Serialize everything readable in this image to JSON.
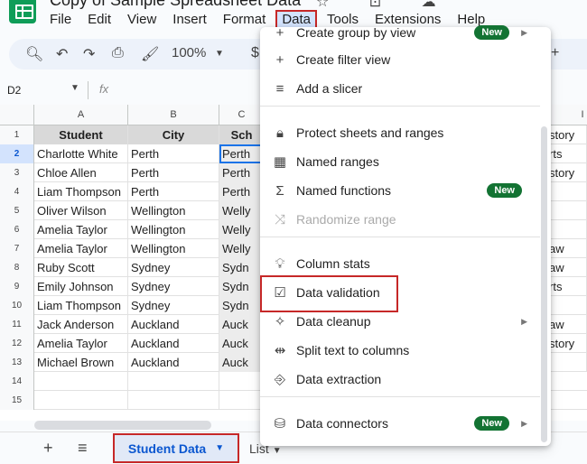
{
  "app": {
    "title": "Copy of Sample Spreadsheet Data",
    "menu": [
      "File",
      "Edit",
      "View",
      "Insert",
      "Format",
      "Data",
      "Tools",
      "Extensions",
      "Help"
    ]
  },
  "toolbar": {
    "zoom": "100%",
    "currency": "$"
  },
  "formula_bar": {
    "cell_ref": "D2",
    "fx": "fx"
  },
  "grid": {
    "columns": [
      "A",
      "B",
      "C",
      "I"
    ],
    "header": {
      "student": "Student",
      "city": "City",
      "school": "Sch"
    },
    "row_numbers": [
      "1",
      "2",
      "3",
      "4",
      "5",
      "6",
      "7",
      "8",
      "9",
      "10",
      "11",
      "12",
      "13",
      "14",
      "15"
    ],
    "rows": [
      {
        "student": "Charlotte White",
        "city": "Perth",
        "school": "Perth",
        "right": "rts"
      },
      {
        "student": "Chloe Allen",
        "city": "Perth",
        "school": "Perth",
        "right": "story"
      },
      {
        "student": "Liam Thompson",
        "city": "Perth",
        "school": "Perth",
        "right": ""
      },
      {
        "student": "Oliver Wilson",
        "city": "Wellington",
        "school": "Welly",
        "right": ""
      },
      {
        "student": "Amelia Taylor",
        "city": "Wellington",
        "school": "Welly",
        "right": ""
      },
      {
        "student": "Amelia Taylor",
        "city": "Wellington",
        "school": "Welly",
        "right": "aw"
      },
      {
        "student": "Ruby Scott",
        "city": "Sydney",
        "school": "Sydn",
        "right": "aw"
      },
      {
        "student": "Emily Johnson",
        "city": "Sydney",
        "school": "Sydn",
        "right": "rts"
      },
      {
        "student": "Liam Thompson",
        "city": "Sydney",
        "school": "Sydn",
        "right": ""
      },
      {
        "student": "Jack Anderson",
        "city": "Auckland",
        "school": "Auck",
        "right": "aw"
      },
      {
        "student": "Amelia Taylor",
        "city": "Auckland",
        "school": "Auck",
        "right": "story"
      },
      {
        "student": "Michael Brown",
        "city": "Auckland",
        "school": "Auck",
        "right": ""
      }
    ],
    "header_right": "story"
  },
  "data_menu": {
    "items": [
      {
        "label": "Create group by view",
        "icon": "plus-icon",
        "badge": "New",
        "arrow": true
      },
      {
        "label": "Create filter view",
        "icon": "plus-icon"
      },
      {
        "label": "Add a slicer",
        "icon": "slicer-icon"
      },
      {
        "label": "Protect sheets and ranges",
        "icon": "lock-icon"
      },
      {
        "label": "Named ranges",
        "icon": "table-icon"
      },
      {
        "label": "Named functions",
        "icon": "sigma-icon",
        "badge": "New"
      },
      {
        "label": "Randomize range",
        "icon": "shuffle-icon",
        "disabled": true
      },
      {
        "label": "Column stats",
        "icon": "lightbulb-icon"
      },
      {
        "label": "Data validation",
        "icon": "validation-icon"
      },
      {
        "label": "Data cleanup",
        "icon": "wand-icon",
        "arrow": true
      },
      {
        "label": "Split text to columns",
        "icon": "split-icon"
      },
      {
        "label": "Data extraction",
        "icon": "extract-icon"
      },
      {
        "label": "Data connectors",
        "icon": "database-icon",
        "badge": "New",
        "arrow": true
      }
    ]
  },
  "sheets": {
    "active": "Student Data",
    "other": "List"
  }
}
